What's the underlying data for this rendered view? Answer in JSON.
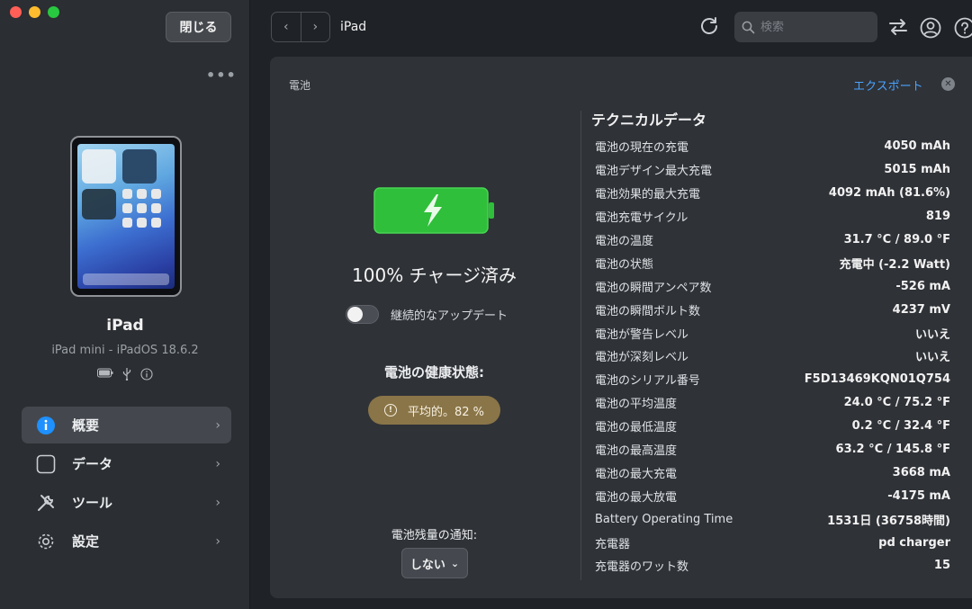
{
  "window": {
    "close_label": "閉じる",
    "more_label": "•••"
  },
  "device": {
    "name": "iPad",
    "model": "iPad mini - iPadOS 18.6.2"
  },
  "sidebar": {
    "items": [
      {
        "label": "概要",
        "icon": "info-icon",
        "active": true
      },
      {
        "label": "データ",
        "icon": "square-icon",
        "active": false
      },
      {
        "label": "ツール",
        "icon": "tools-icon",
        "active": false
      },
      {
        "label": "設定",
        "icon": "gear-icon",
        "active": false
      }
    ]
  },
  "topbar": {
    "title": "iPad",
    "search_placeholder": "検索"
  },
  "panel": {
    "title": "電池",
    "export_label": "エクスポート",
    "battery_status": "100% チャージ済み",
    "continuous_update_label": "継続的なアップデート",
    "continuous_update_on": false,
    "health_title": "電池の健康状態:",
    "health_badge": "平均的。82 %",
    "notify_title": "電池残量の通知:",
    "notify_value": "しない",
    "tech_title": "テクニカルデータ",
    "tech_rows": [
      {
        "k": "電池の現在の充電",
        "v": "4050 mAh"
      },
      {
        "k": "電池デザイン最大充電",
        "v": "5015 mAh"
      },
      {
        "k": "電池効果的最大充電",
        "v": "4092 mAh (81.6%)"
      },
      {
        "k": "電池充電サイクル",
        "v": "819"
      },
      {
        "k": "電池の温度",
        "v": "31.7 °C / 89.0 °F"
      },
      {
        "k": "電池の状態",
        "v": "充電中 (-2.2 Watt)"
      },
      {
        "k": "電池の瞬間アンペア数",
        "v": "-526 mA"
      },
      {
        "k": "電池の瞬間ボルト数",
        "v": "4237 mV"
      },
      {
        "k": "電池が警告レベル",
        "v": "いいえ"
      },
      {
        "k": "電池が深刻レベル",
        "v": "いいえ"
      },
      {
        "k": "電池のシリアル番号",
        "v": "F5D13469KQN01Q754"
      },
      {
        "k": "電池の平均温度",
        "v": "24.0 °C / 75.2 °F"
      },
      {
        "k": "電池の最低温度",
        "v": "0.2 °C / 32.4 °F"
      },
      {
        "k": "電池の最高温度",
        "v": "63.2 °C / 145.8 °F"
      },
      {
        "k": "電池の最大充電",
        "v": "3668 mA"
      },
      {
        "k": "電池の最大放電",
        "v": "-4175 mA"
      },
      {
        "k": "Battery Operating Time",
        "v": "1531日 (36758時間)"
      },
      {
        "k": "充電器",
        "v": "pd charger"
      },
      {
        "k": "充電器のワット数",
        "v": "15"
      }
    ]
  },
  "colors": {
    "accent": "#4aa3ff",
    "battery_green": "#2fbf3a",
    "health_badge": "#8a7548",
    "active_nav": "#44484e"
  }
}
